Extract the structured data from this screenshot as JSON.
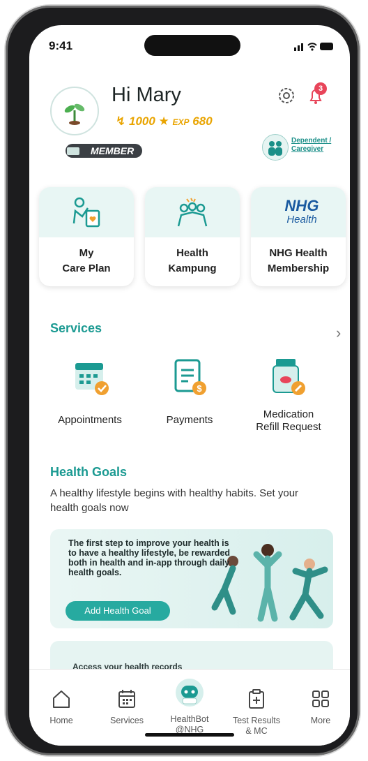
{
  "status": {
    "time": "9:41"
  },
  "header": {
    "greeting": "Hi Mary",
    "points_value": "1000",
    "exp_label": "EXP",
    "exp_value": "680",
    "member_label": "MEMBER",
    "notification_count": "3",
    "dependent_link": "Dependent / Caregiver"
  },
  "cards": [
    {
      "label": "My\nCare Plan"
    },
    {
      "label": "Health\nKampung"
    },
    {
      "label": "NHG Health\nMembership",
      "logo_text": "NHG",
      "logo_sub": "Health"
    }
  ],
  "services": {
    "title": "Services",
    "items": [
      {
        "label": "Appointments"
      },
      {
        "label": "Payments"
      },
      {
        "label": "Medication\nRefill Request"
      }
    ]
  },
  "health_goals": {
    "title": "Health Goals",
    "subtitle": "A healthy lifestyle begins with healthy habits. Set your health goals now",
    "banner_text": "The first step to improve your health is to have a healthy lifestyle, be rewarded both in health and in-app through daily health goals.",
    "banner_button": "Add Health Goal",
    "banner2_text": "Access your health records"
  },
  "nav": {
    "items": [
      {
        "label": "Home"
      },
      {
        "label": "Services"
      },
      {
        "label": "HealthBot\n@NHG"
      },
      {
        "label": "Test Results\n& MC"
      },
      {
        "label": "More"
      }
    ]
  },
  "colors": {
    "accent": "#1b9a92",
    "gold": "#e9a400",
    "badge": "#e8455a"
  }
}
